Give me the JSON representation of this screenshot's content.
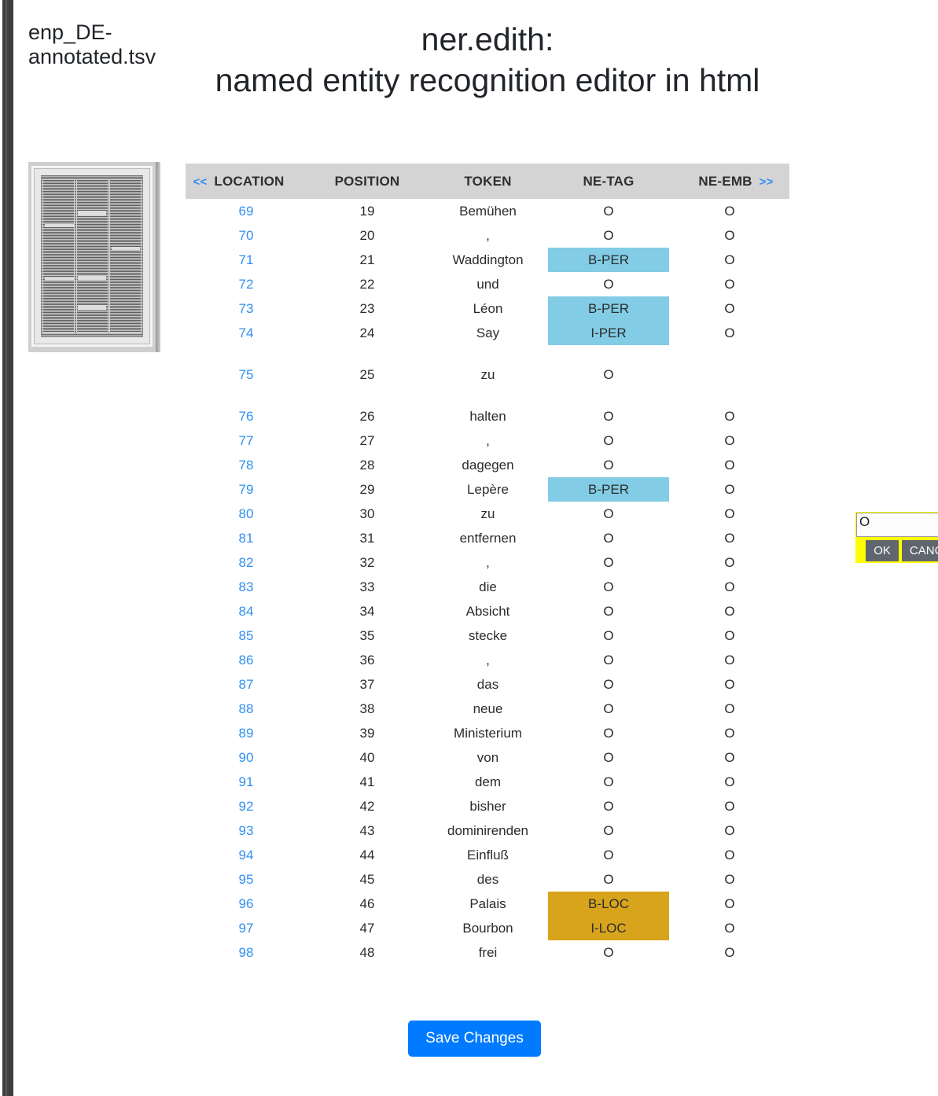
{
  "file": {
    "name": "enp_DE-annotated.tsv"
  },
  "header": {
    "title_line1": "ner.edith:",
    "title_line2": "named entity recognition editor in html"
  },
  "thumbnail": {
    "alt": "scanned-newspaper-page"
  },
  "table": {
    "nav_prev": "<<",
    "nav_next": ">>",
    "columns": [
      "LOCATION",
      "POSITION",
      "TOKEN",
      "NE-TAG",
      "NE-EMB"
    ],
    "rows": [
      {
        "location": "69",
        "position": "19",
        "token": "Bemühen",
        "ne_tag": "O",
        "ne_emb": "O",
        "tag_kind": "none",
        "emb_kind": "none",
        "active": false
      },
      {
        "location": "70",
        "position": "20",
        "token": ",",
        "ne_tag": "O",
        "ne_emb": "O",
        "tag_kind": "none",
        "emb_kind": "none",
        "active": false
      },
      {
        "location": "71",
        "position": "21",
        "token": "Waddington",
        "ne_tag": "B-PER",
        "ne_emb": "O",
        "tag_kind": "per",
        "emb_kind": "none",
        "active": false
      },
      {
        "location": "72",
        "position": "22",
        "token": "und",
        "ne_tag": "O",
        "ne_emb": "O",
        "tag_kind": "none",
        "emb_kind": "none",
        "active": false
      },
      {
        "location": "73",
        "position": "23",
        "token": "Léon",
        "ne_tag": "B-PER",
        "ne_emb": "O",
        "tag_kind": "per",
        "emb_kind": "none",
        "active": false
      },
      {
        "location": "74",
        "position": "24",
        "token": "Say",
        "ne_tag": "I-PER",
        "ne_emb": "O",
        "tag_kind": "per",
        "emb_kind": "none",
        "active": false
      },
      {
        "location": "75",
        "position": "25",
        "token": "zu",
        "ne_tag": "O",
        "ne_emb": "",
        "tag_kind": "none",
        "emb_kind": "none",
        "active": true
      },
      {
        "location": "76",
        "position": "26",
        "token": "halten",
        "ne_tag": "O",
        "ne_emb": "O",
        "tag_kind": "none",
        "emb_kind": "none",
        "active": false
      },
      {
        "location": "77",
        "position": "27",
        "token": ",",
        "ne_tag": "O",
        "ne_emb": "O",
        "tag_kind": "none",
        "emb_kind": "none",
        "active": false
      },
      {
        "location": "78",
        "position": "28",
        "token": "dagegen",
        "ne_tag": "O",
        "ne_emb": "O",
        "tag_kind": "none",
        "emb_kind": "none",
        "active": false
      },
      {
        "location": "79",
        "position": "29",
        "token": "Lepère",
        "ne_tag": "B-PER",
        "ne_emb": "O",
        "tag_kind": "per",
        "emb_kind": "none",
        "active": false
      },
      {
        "location": "80",
        "position": "30",
        "token": "zu",
        "ne_tag": "O",
        "ne_emb": "O",
        "tag_kind": "none",
        "emb_kind": "none",
        "active": false
      },
      {
        "location": "81",
        "position": "31",
        "token": "entfernen",
        "ne_tag": "O",
        "ne_emb": "O",
        "tag_kind": "none",
        "emb_kind": "none",
        "active": false
      },
      {
        "location": "82",
        "position": "32",
        "token": ",",
        "ne_tag": "O",
        "ne_emb": "O",
        "tag_kind": "none",
        "emb_kind": "none",
        "active": false
      },
      {
        "location": "83",
        "position": "33",
        "token": "die",
        "ne_tag": "O",
        "ne_emb": "O",
        "tag_kind": "none",
        "emb_kind": "none",
        "active": false
      },
      {
        "location": "84",
        "position": "34",
        "token": "Absicht",
        "ne_tag": "O",
        "ne_emb": "O",
        "tag_kind": "none",
        "emb_kind": "none",
        "active": false
      },
      {
        "location": "85",
        "position": "35",
        "token": "stecke",
        "ne_tag": "O",
        "ne_emb": "O",
        "tag_kind": "none",
        "emb_kind": "none",
        "active": false
      },
      {
        "location": "86",
        "position": "36",
        "token": ",",
        "ne_tag": "O",
        "ne_emb": "O",
        "tag_kind": "none",
        "emb_kind": "none",
        "active": false
      },
      {
        "location": "87",
        "position": "37",
        "token": "das",
        "ne_tag": "O",
        "ne_emb": "O",
        "tag_kind": "none",
        "emb_kind": "none",
        "active": false
      },
      {
        "location": "88",
        "position": "38",
        "token": "neue",
        "ne_tag": "O",
        "ne_emb": "O",
        "tag_kind": "none",
        "emb_kind": "none",
        "active": false
      },
      {
        "location": "89",
        "position": "39",
        "token": "Ministerium",
        "ne_tag": "O",
        "ne_emb": "O",
        "tag_kind": "none",
        "emb_kind": "none",
        "active": false
      },
      {
        "location": "90",
        "position": "40",
        "token": "von",
        "ne_tag": "O",
        "ne_emb": "O",
        "tag_kind": "none",
        "emb_kind": "none",
        "active": false
      },
      {
        "location": "91",
        "position": "41",
        "token": "dem",
        "ne_tag": "O",
        "ne_emb": "O",
        "tag_kind": "none",
        "emb_kind": "none",
        "active": false
      },
      {
        "location": "92",
        "position": "42",
        "token": "bisher",
        "ne_tag": "O",
        "ne_emb": "O",
        "tag_kind": "none",
        "emb_kind": "none",
        "active": false
      },
      {
        "location": "93",
        "position": "43",
        "token": "dominirenden",
        "ne_tag": "O",
        "ne_emb": "O",
        "tag_kind": "none",
        "emb_kind": "none",
        "active": false
      },
      {
        "location": "94",
        "position": "44",
        "token": "Einfluß",
        "ne_tag": "O",
        "ne_emb": "O",
        "tag_kind": "none",
        "emb_kind": "none",
        "active": false
      },
      {
        "location": "95",
        "position": "45",
        "token": "des",
        "ne_tag": "O",
        "ne_emb": "O",
        "tag_kind": "none",
        "emb_kind": "none",
        "active": false
      },
      {
        "location": "96",
        "position": "46",
        "token": "Palais",
        "ne_tag": "B-LOC",
        "ne_emb": "O",
        "tag_kind": "loc",
        "emb_kind": "none",
        "active": false
      },
      {
        "location": "97",
        "position": "47",
        "token": "Bourbon",
        "ne_tag": "I-LOC",
        "ne_emb": "O",
        "tag_kind": "loc",
        "emb_kind": "none",
        "active": false
      },
      {
        "location": "98",
        "position": "48",
        "token": "frei",
        "ne_tag": "O",
        "ne_emb": "O",
        "tag_kind": "none",
        "emb_kind": "none",
        "active": false
      }
    ]
  },
  "edit_popup": {
    "value": "O",
    "placeholder": "",
    "ok_label": "OK",
    "cancel_label": "CANCEL"
  },
  "footer": {
    "save_label": "Save Changes"
  },
  "colors": {
    "tag_per": "#82cce6",
    "tag_loc": "#d7a41c",
    "link": "#2f8ff0",
    "header_bg": "#d4d4d4",
    "popup_bg": "#ffff00",
    "save_bg": "#007bff"
  }
}
